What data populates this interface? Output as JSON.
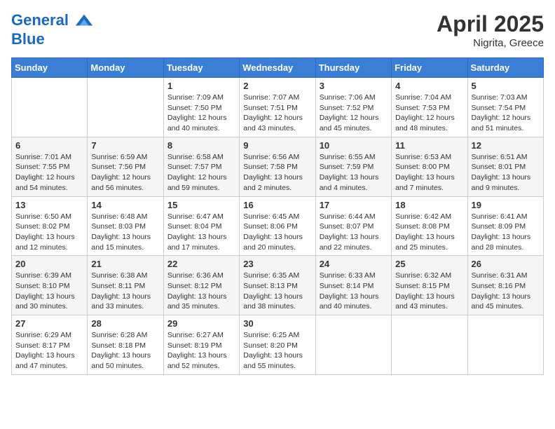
{
  "header": {
    "logo_line1": "General",
    "logo_line2": "Blue",
    "month_year": "April 2025",
    "location": "Nigrita, Greece"
  },
  "weekdays": [
    "Sunday",
    "Monday",
    "Tuesday",
    "Wednesday",
    "Thursday",
    "Friday",
    "Saturday"
  ],
  "weeks": [
    [
      {
        "day": "",
        "sunrise": "",
        "sunset": "",
        "daylight": ""
      },
      {
        "day": "",
        "sunrise": "",
        "sunset": "",
        "daylight": ""
      },
      {
        "day": "1",
        "sunrise": "Sunrise: 7:09 AM",
        "sunset": "Sunset: 7:50 PM",
        "daylight": "Daylight: 12 hours and 40 minutes."
      },
      {
        "day": "2",
        "sunrise": "Sunrise: 7:07 AM",
        "sunset": "Sunset: 7:51 PM",
        "daylight": "Daylight: 12 hours and 43 minutes."
      },
      {
        "day": "3",
        "sunrise": "Sunrise: 7:06 AM",
        "sunset": "Sunset: 7:52 PM",
        "daylight": "Daylight: 12 hours and 45 minutes."
      },
      {
        "day": "4",
        "sunrise": "Sunrise: 7:04 AM",
        "sunset": "Sunset: 7:53 PM",
        "daylight": "Daylight: 12 hours and 48 minutes."
      },
      {
        "day": "5",
        "sunrise": "Sunrise: 7:03 AM",
        "sunset": "Sunset: 7:54 PM",
        "daylight": "Daylight: 12 hours and 51 minutes."
      }
    ],
    [
      {
        "day": "6",
        "sunrise": "Sunrise: 7:01 AM",
        "sunset": "Sunset: 7:55 PM",
        "daylight": "Daylight: 12 hours and 54 minutes."
      },
      {
        "day": "7",
        "sunrise": "Sunrise: 6:59 AM",
        "sunset": "Sunset: 7:56 PM",
        "daylight": "Daylight: 12 hours and 56 minutes."
      },
      {
        "day": "8",
        "sunrise": "Sunrise: 6:58 AM",
        "sunset": "Sunset: 7:57 PM",
        "daylight": "Daylight: 12 hours and 59 minutes."
      },
      {
        "day": "9",
        "sunrise": "Sunrise: 6:56 AM",
        "sunset": "Sunset: 7:58 PM",
        "daylight": "Daylight: 13 hours and 2 minutes."
      },
      {
        "day": "10",
        "sunrise": "Sunrise: 6:55 AM",
        "sunset": "Sunset: 7:59 PM",
        "daylight": "Daylight: 13 hours and 4 minutes."
      },
      {
        "day": "11",
        "sunrise": "Sunrise: 6:53 AM",
        "sunset": "Sunset: 8:00 PM",
        "daylight": "Daylight: 13 hours and 7 minutes."
      },
      {
        "day": "12",
        "sunrise": "Sunrise: 6:51 AM",
        "sunset": "Sunset: 8:01 PM",
        "daylight": "Daylight: 13 hours and 9 minutes."
      }
    ],
    [
      {
        "day": "13",
        "sunrise": "Sunrise: 6:50 AM",
        "sunset": "Sunset: 8:02 PM",
        "daylight": "Daylight: 13 hours and 12 minutes."
      },
      {
        "day": "14",
        "sunrise": "Sunrise: 6:48 AM",
        "sunset": "Sunset: 8:03 PM",
        "daylight": "Daylight: 13 hours and 15 minutes."
      },
      {
        "day": "15",
        "sunrise": "Sunrise: 6:47 AM",
        "sunset": "Sunset: 8:04 PM",
        "daylight": "Daylight: 13 hours and 17 minutes."
      },
      {
        "day": "16",
        "sunrise": "Sunrise: 6:45 AM",
        "sunset": "Sunset: 8:06 PM",
        "daylight": "Daylight: 13 hours and 20 minutes."
      },
      {
        "day": "17",
        "sunrise": "Sunrise: 6:44 AM",
        "sunset": "Sunset: 8:07 PM",
        "daylight": "Daylight: 13 hours and 22 minutes."
      },
      {
        "day": "18",
        "sunrise": "Sunrise: 6:42 AM",
        "sunset": "Sunset: 8:08 PM",
        "daylight": "Daylight: 13 hours and 25 minutes."
      },
      {
        "day": "19",
        "sunrise": "Sunrise: 6:41 AM",
        "sunset": "Sunset: 8:09 PM",
        "daylight": "Daylight: 13 hours and 28 minutes."
      }
    ],
    [
      {
        "day": "20",
        "sunrise": "Sunrise: 6:39 AM",
        "sunset": "Sunset: 8:10 PM",
        "daylight": "Daylight: 13 hours and 30 minutes."
      },
      {
        "day": "21",
        "sunrise": "Sunrise: 6:38 AM",
        "sunset": "Sunset: 8:11 PM",
        "daylight": "Daylight: 13 hours and 33 minutes."
      },
      {
        "day": "22",
        "sunrise": "Sunrise: 6:36 AM",
        "sunset": "Sunset: 8:12 PM",
        "daylight": "Daylight: 13 hours and 35 minutes."
      },
      {
        "day": "23",
        "sunrise": "Sunrise: 6:35 AM",
        "sunset": "Sunset: 8:13 PM",
        "daylight": "Daylight: 13 hours and 38 minutes."
      },
      {
        "day": "24",
        "sunrise": "Sunrise: 6:33 AM",
        "sunset": "Sunset: 8:14 PM",
        "daylight": "Daylight: 13 hours and 40 minutes."
      },
      {
        "day": "25",
        "sunrise": "Sunrise: 6:32 AM",
        "sunset": "Sunset: 8:15 PM",
        "daylight": "Daylight: 13 hours and 43 minutes."
      },
      {
        "day": "26",
        "sunrise": "Sunrise: 6:31 AM",
        "sunset": "Sunset: 8:16 PM",
        "daylight": "Daylight: 13 hours and 45 minutes."
      }
    ],
    [
      {
        "day": "27",
        "sunrise": "Sunrise: 6:29 AM",
        "sunset": "Sunset: 8:17 PM",
        "daylight": "Daylight: 13 hours and 47 minutes."
      },
      {
        "day": "28",
        "sunrise": "Sunrise: 6:28 AM",
        "sunset": "Sunset: 8:18 PM",
        "daylight": "Daylight: 13 hours and 50 minutes."
      },
      {
        "day": "29",
        "sunrise": "Sunrise: 6:27 AM",
        "sunset": "Sunset: 8:19 PM",
        "daylight": "Daylight: 13 hours and 52 minutes."
      },
      {
        "day": "30",
        "sunrise": "Sunrise: 6:25 AM",
        "sunset": "Sunset: 8:20 PM",
        "daylight": "Daylight: 13 hours and 55 minutes."
      },
      {
        "day": "",
        "sunrise": "",
        "sunset": "",
        "daylight": ""
      },
      {
        "day": "",
        "sunrise": "",
        "sunset": "",
        "daylight": ""
      },
      {
        "day": "",
        "sunrise": "",
        "sunset": "",
        "daylight": ""
      }
    ]
  ]
}
